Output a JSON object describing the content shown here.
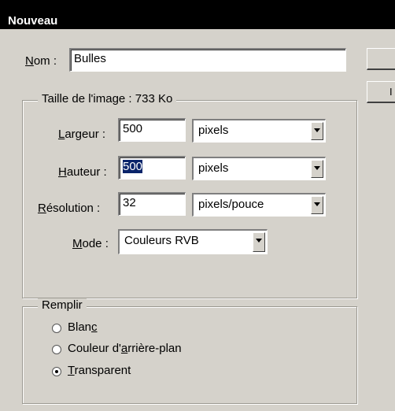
{
  "titlebar": {
    "title": "Nouveau"
  },
  "name": {
    "label": "Nom :",
    "value": "Bulles"
  },
  "image_size": {
    "legend": "Taille de l'image :",
    "size": "733 Ko"
  },
  "fields": {
    "width": {
      "label": "Largeur :",
      "value": "500",
      "unit": "pixels"
    },
    "height": {
      "label": "Hauteur :",
      "value": "500",
      "unit": "pixels"
    },
    "resolution": {
      "label": "Résolution :",
      "value": "32",
      "unit": "pixels/pouce"
    },
    "mode": {
      "label": "Mode :",
      "value": "Couleurs RVB"
    }
  },
  "fill": {
    "legend": "Remplir",
    "options": [
      {
        "label": "Blanc",
        "selected": false
      },
      {
        "label": "Couleur d'arrière-plan",
        "selected": false
      },
      {
        "label": "Transparent",
        "selected": true
      }
    ]
  }
}
